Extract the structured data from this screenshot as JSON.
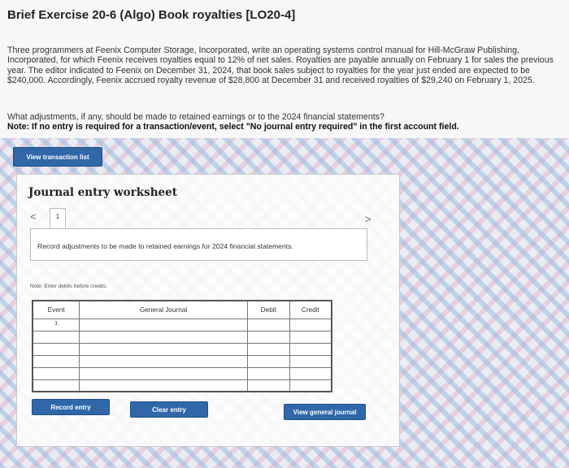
{
  "header": {
    "title": "Brief Exercise 20-6 (Algo) Book royalties [LO20-4]"
  },
  "problem": {
    "text": "Three programmers at Feenix Computer Storage, Incorporated, write an operating systems control manual for Hill-McGraw Publishing, Incorporated, for which Feenix receives royalties equal to 12% of net sales. Royalties are payable annually on February 1 for sales the previous year. The editor indicated to Feenix on December 31, 2024, that book sales subject to royalties for the year just ended are expected to be $240,000. Accordingly, Feenix accrued royalty revenue of $28,800 at December 31 and received royalties of $29,240 on February 1, 2025.",
    "question": "What adjustments, if any, should be made to retained earnings or to the 2024 financial statements?",
    "note": "Note: If no entry is required for a transaction/event, select \"No journal entry required\" in the first account field."
  },
  "buttons": {
    "view_transaction_list": "View transaction list",
    "record_entry": "Record entry",
    "clear_entry": "Clear entry",
    "view_general_journal": "View general journal"
  },
  "worksheet": {
    "title": "Journal entry worksheet",
    "prev_icon": "<",
    "next_icon": ">",
    "active_tab": "1",
    "instruction": "Record adjustments to be made to retained earnings for 2024 financial statements.",
    "debits_note": "Note: Enter debits before credits."
  },
  "journal": {
    "columns": [
      "Event",
      "General Journal",
      "Debit",
      "Credit"
    ],
    "rows": [
      {
        "event": "1"
      },
      {
        "event": ""
      },
      {
        "event": ""
      },
      {
        "event": ""
      },
      {
        "event": ""
      },
      {
        "event": ""
      }
    ]
  },
  "colors": {
    "button_blue": "#2f67a8"
  }
}
